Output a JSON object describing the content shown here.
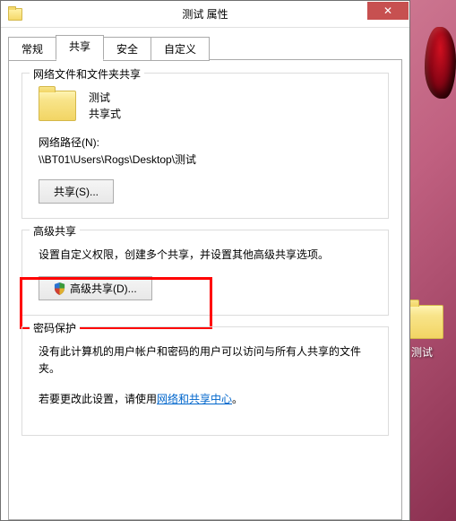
{
  "dialog": {
    "title": "测试 属性",
    "close_glyph": "✕"
  },
  "tabs": {
    "general": "常规",
    "sharing": "共享",
    "security": "安全",
    "custom": "自定义"
  },
  "sharing": {
    "network_group_title": "网络文件和文件夹共享",
    "folder_name": "测试",
    "share_status": "共享式",
    "network_path_label": "网络路径(N):",
    "network_path_value": "\\\\BT01\\Users\\Rogs\\Desktop\\测试",
    "share_button": "共享(S)..."
  },
  "advanced": {
    "group_title": "高级共享",
    "description": "设置自定义权限，创建多个共享，并设置其他高级共享选项。",
    "button_label": "高级共享(D)..."
  },
  "password": {
    "group_title": "密码保护",
    "description": "没有此计算机的用户帐户和密码的用户可以访问与所有人共享的文件夹。",
    "note_prefix": "若要更改此设置，请使用",
    "link_text": "网络和共享中心",
    "note_suffix": "。"
  },
  "desktop": {
    "folder_label": "测试"
  }
}
